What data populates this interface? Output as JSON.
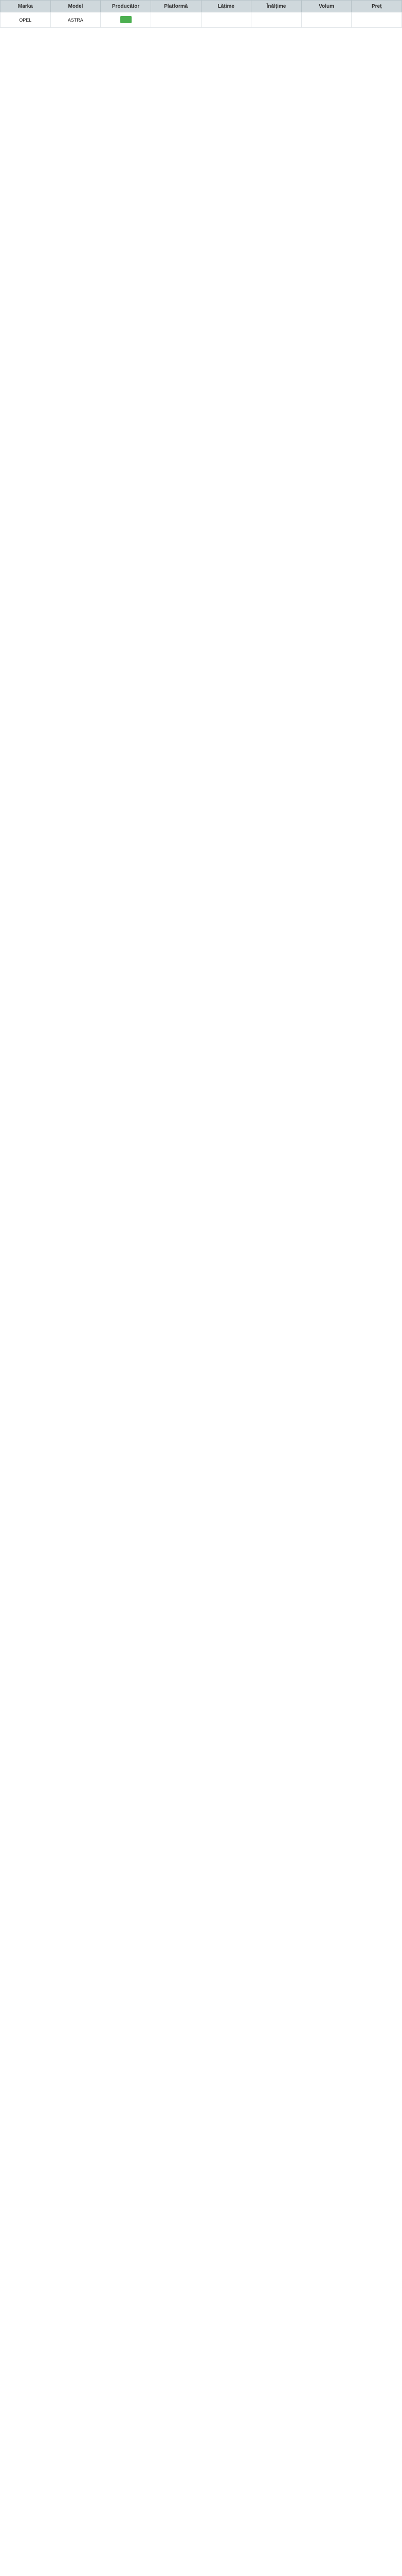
{
  "columns": [
    "Marka",
    "Model",
    "Producător",
    "Platformă",
    "Lățime",
    "Înălțime",
    "Volum",
    "Preț"
  ],
  "rows": [
    {
      "brand": "OPEL",
      "model": "ASTRA",
      "platform": "",
      "width": "",
      "height": "",
      "volume": "",
      "note": "",
      "price": ""
    }
  ]
}
